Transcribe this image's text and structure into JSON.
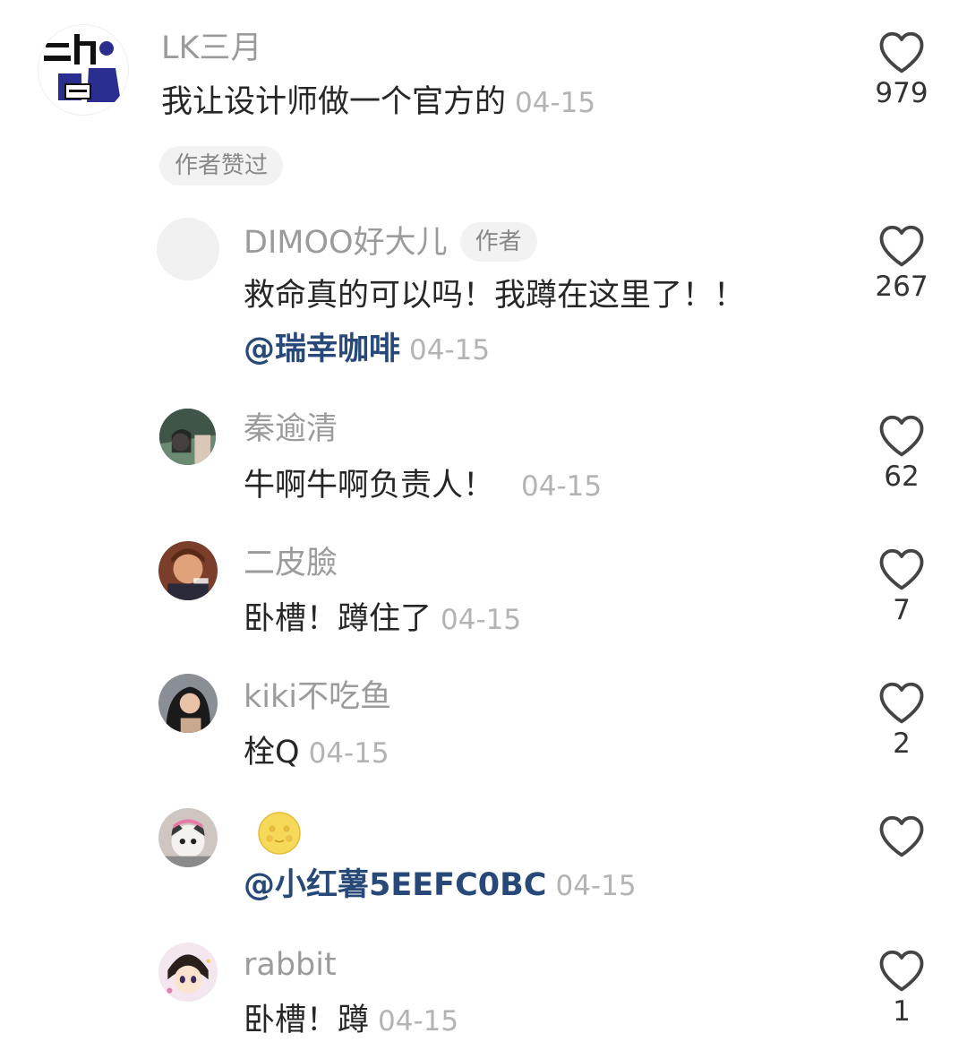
{
  "comments": [
    {
      "username": "LK三月",
      "text": "我让设计师做一个官方的",
      "date": "04-15",
      "likes": "979",
      "badge": "作者赞过"
    },
    {
      "username": "DIMOO好大儿",
      "author_tag": "作者",
      "text": "救命真的可以吗！我蹲在这里了！！",
      "mention": "@瑞幸咖啡",
      "date": "04-15",
      "likes": "267"
    },
    {
      "username": "秦逾清",
      "text": "牛啊牛啊负责人！",
      "date": "04-15",
      "likes": "62"
    },
    {
      "username": "二皮臉",
      "text": "卧槽！蹲住了",
      "date": "04-15",
      "likes": "7"
    },
    {
      "username": "kiki不吃鱼",
      "text": "栓Q",
      "date": "04-15",
      "likes": "2"
    },
    {
      "username_icon": "moon-face-emoji",
      "mention": "@小红薯5EEFC0BC",
      "date": "04-15",
      "likes": ""
    },
    {
      "username": "rabbit",
      "text": "卧槽！蹲",
      "date": "04-15",
      "likes": "1"
    }
  ],
  "icons": {
    "like": "heart-outline-icon"
  },
  "colors": {
    "mention": "#27497a",
    "username": "#9b9b9b",
    "date": "#b3b3b3"
  }
}
